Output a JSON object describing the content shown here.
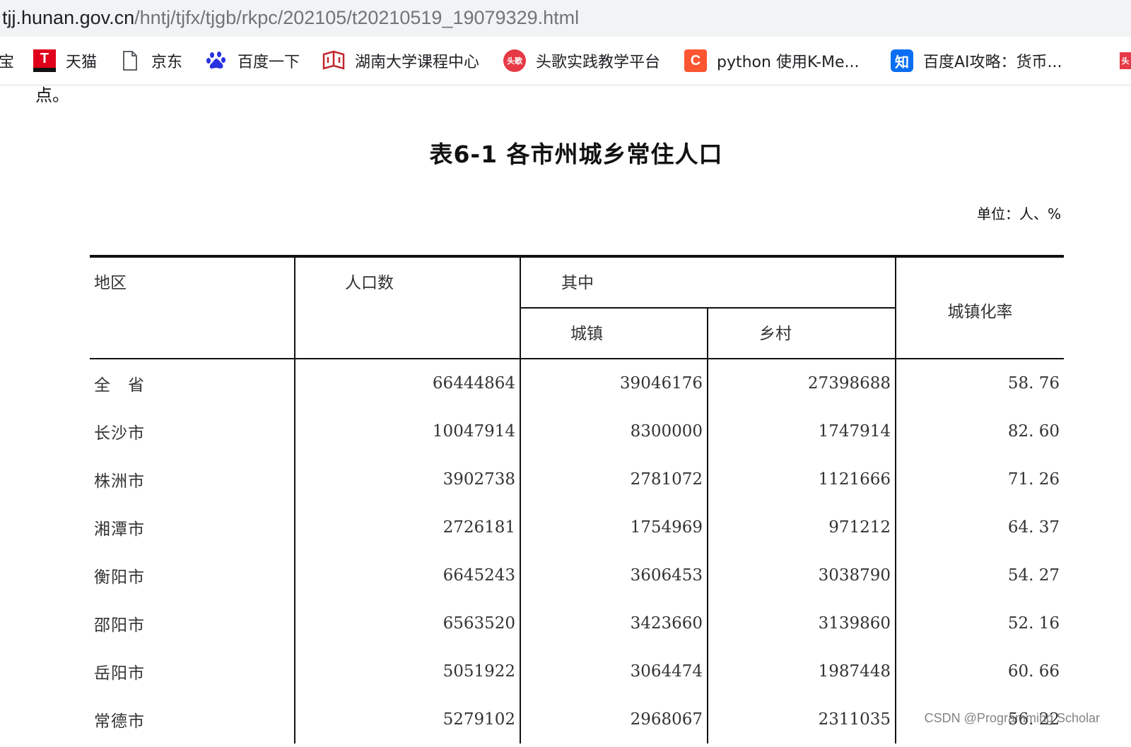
{
  "address_bar": {
    "host": "tjj.hunan.gov.cn",
    "path": "/hntj/tjfx/tjgb/rkpc/202105/t20210519_19079329.html"
  },
  "bookmarks": [
    {
      "label": "宝",
      "icon": "none"
    },
    {
      "label": "天猫",
      "icon": "tmall-icon",
      "glyph": "T"
    },
    {
      "label": "京东",
      "icon": "document-icon"
    },
    {
      "label": "百度一下",
      "icon": "baidu-paw-icon"
    },
    {
      "label": "湖南大学课程中心",
      "icon": "hnu-icon"
    },
    {
      "label": "头歌实践教学平台",
      "icon": "tougee-icon",
      "glyph": "头歌"
    },
    {
      "label": "python 使用K-Me...",
      "icon": "csdn-icon",
      "glyph": "C"
    },
    {
      "label": "百度AI攻略：货币...",
      "icon": "zhihu-icon",
      "glyph": "知"
    },
    {
      "label": "",
      "icon": "toutiao-icon",
      "glyph": "头"
    }
  ],
  "page": {
    "leftover_text": "点。",
    "title": "表6-1 各市州城乡常住人口",
    "unit": "单位：人、%"
  },
  "table": {
    "headers": {
      "region": "地区",
      "population": "人口数",
      "of_which": "其中",
      "urban": "城镇",
      "rural": "乡村",
      "urbanization_rate": "城镇化率"
    },
    "rows": [
      {
        "region": "全　省",
        "population": "66444864",
        "urban": "39046176",
        "rural": "27398688",
        "rate": "58. 76"
      },
      {
        "region": "长沙市",
        "population": "10047914",
        "urban": "8300000",
        "rural": "1747914",
        "rate": "82. 60"
      },
      {
        "region": "株洲市",
        "population": "3902738",
        "urban": "2781072",
        "rural": "1121666",
        "rate": "71. 26"
      },
      {
        "region": "湘潭市",
        "population": "2726181",
        "urban": "1754969",
        "rural": "971212",
        "rate": "64. 37"
      },
      {
        "region": "衡阳市",
        "population": "6645243",
        "urban": "3606453",
        "rural": "3038790",
        "rate": "54. 27"
      },
      {
        "region": "邵阳市",
        "population": "6563520",
        "urban": "3423660",
        "rural": "3139860",
        "rate": "52. 16"
      },
      {
        "region": "岳阳市",
        "population": "5051922",
        "urban": "3064474",
        "rural": "1987448",
        "rate": "60. 66"
      },
      {
        "region": "常德市",
        "population": "5279102",
        "urban": "2968067",
        "rural": "2311035",
        "rate": "56. 22"
      }
    ]
  },
  "watermark": "CSDN @Programming Scholar"
}
